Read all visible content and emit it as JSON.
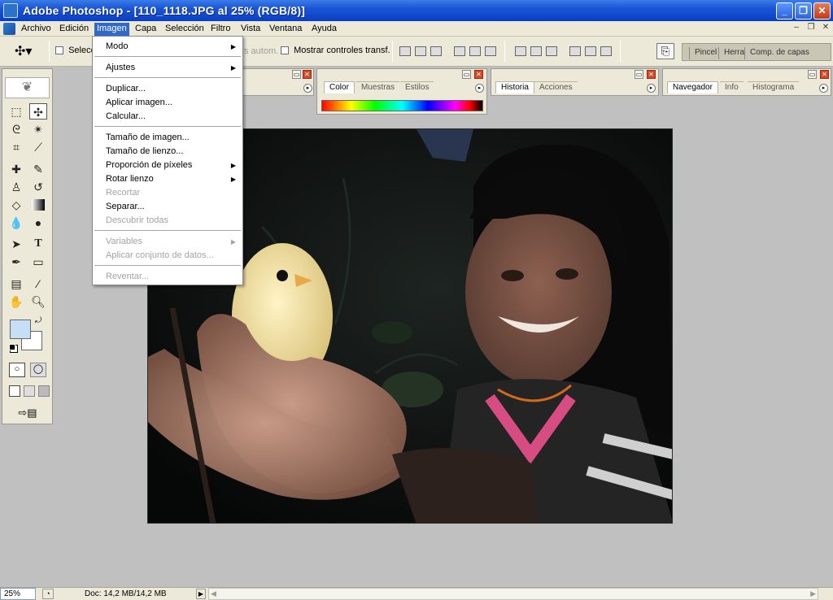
{
  "window": {
    "title": "Adobe Photoshop - [110_1118.JPG al 25% (RGB/8)]",
    "minimize_label": "_",
    "maximize_label": "❐",
    "close_label": "✕"
  },
  "menubar": {
    "items": [
      "Archivo",
      "Edición",
      "Imagen",
      "Capa",
      "Selección",
      "Filtro",
      "Vista",
      "Ventana",
      "Ayuda"
    ],
    "active": "Imagen",
    "doc_min": "–",
    "doc_restore": "❐",
    "doc_close": "✕"
  },
  "options": {
    "auto_select_label": "Selecci",
    "auto_select_hidden": "s autom.",
    "show_transform_label": "Mostrar controles transf.",
    "well_tabs": [
      "Pincel",
      "Herra",
      "Comp. de capas"
    ]
  },
  "palettes": {
    "color": {
      "tabs": [
        "Color",
        "Muestras",
        "Estilos"
      ]
    },
    "history": {
      "tabs": [
        "Historia",
        "Acciones"
      ]
    },
    "navigator": {
      "tabs": [
        "Navegador",
        "Info",
        "Histograma"
      ]
    }
  },
  "image_menu": {
    "items": [
      {
        "label": "Modo",
        "submenu": true,
        "enabled": true
      },
      {
        "label": "Ajustes",
        "submenu": true,
        "enabled": true
      },
      {
        "label": "Duplicar...",
        "enabled": true
      },
      {
        "label": "Aplicar imagen...",
        "enabled": true
      },
      {
        "label": "Calcular...",
        "enabled": true
      },
      {
        "label": "Tamaño de imagen...",
        "enabled": true
      },
      {
        "label": "Tamaño de lienzo...",
        "enabled": true
      },
      {
        "label": "Proporción de píxeles",
        "submenu": true,
        "enabled": true
      },
      {
        "label": "Rotar lienzo",
        "submenu": true,
        "enabled": true
      },
      {
        "label": "Recortar",
        "enabled": false
      },
      {
        "label": "Separar...",
        "enabled": true
      },
      {
        "label": "Descubrir todas",
        "enabled": false
      },
      {
        "label": "Variables",
        "submenu": true,
        "enabled": false
      },
      {
        "label": "Aplicar conjunto de datos...",
        "enabled": false
      },
      {
        "label": "Reventar...",
        "enabled": false
      }
    ]
  },
  "status": {
    "zoom": "25%",
    "doc_info": "Doc: 14,2 MB/14,2 MB"
  },
  "colors": {
    "title_bar": "#1b55d6",
    "menu_highlight": "#316ac5",
    "chrome": "#ece9d8",
    "workspace": "#c0c0c0",
    "foreground_swatch": "#c7dff6",
    "background_swatch": "#ffffff"
  }
}
